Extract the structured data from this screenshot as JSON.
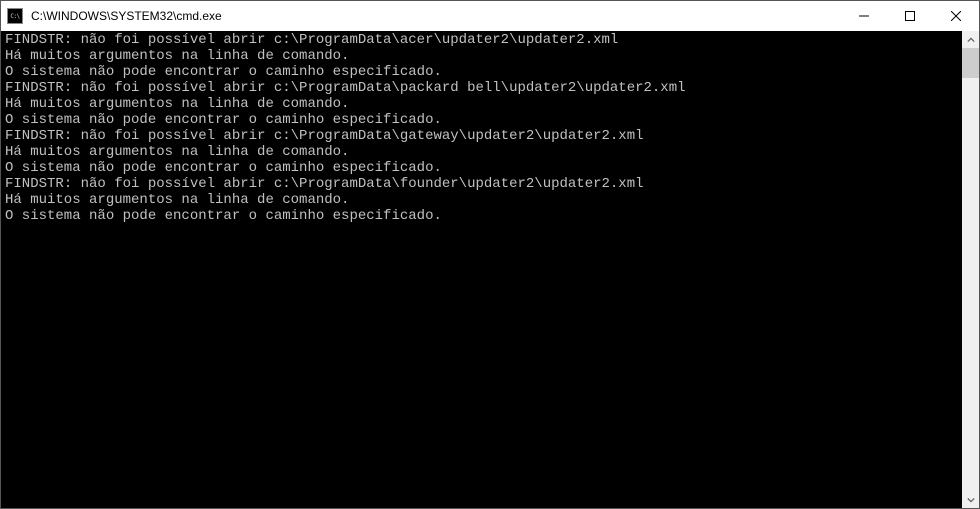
{
  "window": {
    "title": "C:\\WINDOWS\\SYSTEM32\\cmd.exe"
  },
  "console": {
    "lines": [
      "FINDSTR: não foi possível abrir c:\\ProgramData\\acer\\updater2\\updater2.xml",
      "Há muitos argumentos na linha de comando.",
      "O sistema não pode encontrar o caminho especificado.",
      "FINDSTR: não foi possível abrir c:\\ProgramData\\packard bell\\updater2\\updater2.xml",
      "Há muitos argumentos na linha de comando.",
      "O sistema não pode encontrar o caminho especificado.",
      "FINDSTR: não foi possível abrir c:\\ProgramData\\gateway\\updater2\\updater2.xml",
      "Há muitos argumentos na linha de comando.",
      "O sistema não pode encontrar o caminho especificado.",
      "FINDSTR: não foi possível abrir c:\\ProgramData\\founder\\updater2\\updater2.xml",
      "Há muitos argumentos na linha de comando.",
      "O sistema não pode encontrar o caminho especificado."
    ]
  }
}
